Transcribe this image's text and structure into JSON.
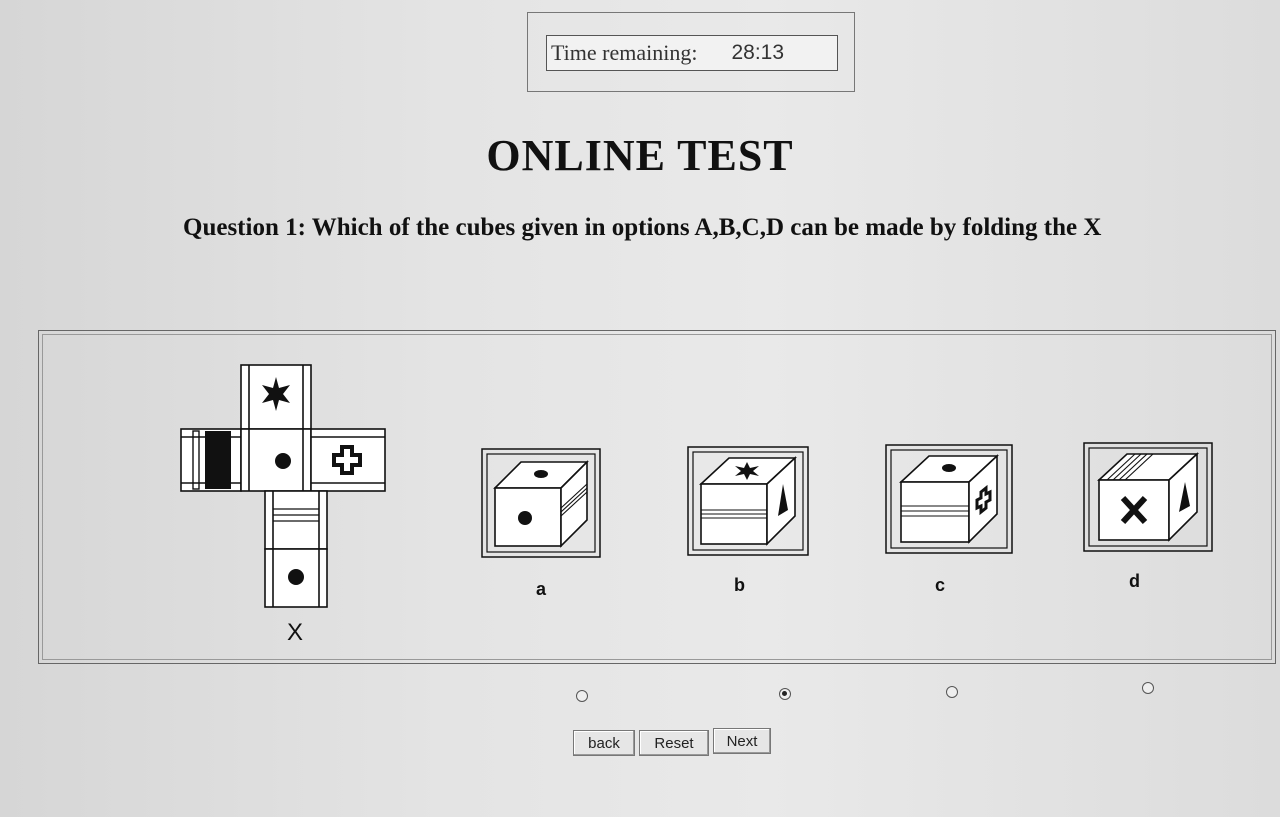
{
  "timer": {
    "label": "Time remaining:",
    "value": "28:13"
  },
  "page_title": "ONLINE TEST",
  "question": {
    "text": "Question 1: Which of the cubes given in options A,B,C,D can be made by folding the X"
  },
  "figure": {
    "net_label": "X",
    "options": [
      {
        "label": "a",
        "selected": false
      },
      {
        "label": "b",
        "selected": true
      },
      {
        "label": "c",
        "selected": false
      },
      {
        "label": "d",
        "selected": false
      }
    ]
  },
  "buttons": {
    "back": "back",
    "reset": "Reset",
    "next": "Next"
  }
}
